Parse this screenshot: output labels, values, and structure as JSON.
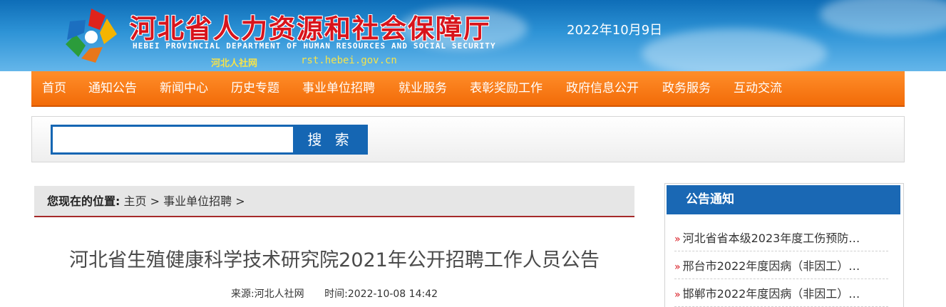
{
  "header": {
    "title_cn": "河北省人力资源和社会保障厅",
    "title_en": "HEBEI PROVINCIAL DEPARTMENT OF HUMAN RESOURCES AND SOCIAL SECURITY",
    "site_name": "河北人社网",
    "site_url": "rst.hebei.gov.cn",
    "date": "2022年10月9日"
  },
  "nav": {
    "items": [
      "首页",
      "通知公告",
      "新闻中心",
      "历史专题",
      "事业单位招聘",
      "就业服务",
      "表彰奖励工作",
      "政府信息公开",
      "政务服务",
      "互动交流"
    ]
  },
  "search": {
    "value": "",
    "button_label": "搜 索"
  },
  "breadcrumb": {
    "label": "您现在的位置:",
    "items": [
      "主页",
      "事业单位招聘"
    ],
    "separator": ">"
  },
  "article": {
    "title": "河北省生殖健康科学技术研究院2021年公开招聘工作人员公告",
    "source": "来源:河北人社网",
    "time": "时间:2022-10-08 14:42"
  },
  "sidebar": {
    "heading": "公告通知",
    "items": [
      "河北省省本级2023年度工伤预防…",
      "邢台市2022年度因病（非因工）…",
      "邯郸市2022年度因病（非因工）…"
    ]
  },
  "colors": {
    "header_blue": "#0e6db7",
    "title_red": "#d8141c",
    "nav_orange": "#f26b08",
    "accent_blue": "#1566b3",
    "breadcrumb_border": "#a52a2a"
  }
}
